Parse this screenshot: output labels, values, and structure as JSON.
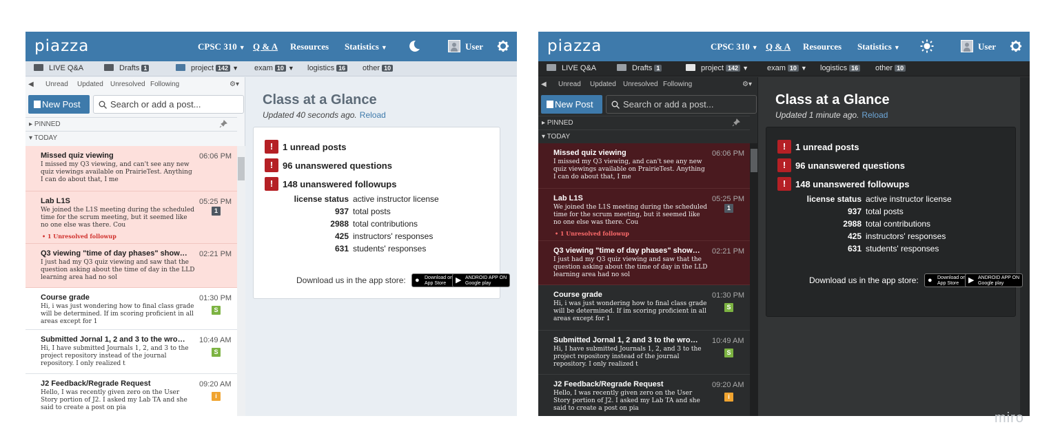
{
  "common": {
    "logo": "piazza",
    "nav": {
      "course": "CPSC 310",
      "qa": "Q & A",
      "resources": "Resources",
      "statistics": "Statistics",
      "user": "User"
    },
    "folders": {
      "live": "LIVE Q&A",
      "drafts": "Drafts",
      "drafts_count": "1",
      "project": "project",
      "project_count": "142",
      "exam": "exam",
      "exam_count": "10",
      "logistics": "logistics",
      "logistics_count": "16",
      "other": "other",
      "other_count": "10"
    },
    "filters": {
      "unread": "Unread",
      "updated": "Updated",
      "unresolved": "Unresolved",
      "following": "Following"
    },
    "new_post": "New Post",
    "search_placeholder": "Search or add a post...",
    "pinned": "PINNED",
    "today": "TODAY",
    "posts": [
      {
        "title": "Missed quiz viewing",
        "time": "06:06 PM",
        "snippet": "I missed my Q3 viewing, and can't see any new quiz viewings available on PrairieTest. Anything I can do about that, I me"
      },
      {
        "title": "Lab L1S",
        "time": "05:25 PM",
        "snippet": "We joined the L1S meeting during the scheduled time for the scrum meeting, but it seemed like no one else was there. Cou",
        "flag": "1",
        "followup": "•  1 Unresolved followup"
      },
      {
        "title": "Q3 viewing \"time of day phases\" show…",
        "time": "02:21 PM",
        "snippet": "I just had my Q3 quiz viewing and saw that the question asking about the time of day in the LLD learning area had no sol"
      },
      {
        "title": "Course grade",
        "time": "01:30 PM",
        "snippet": "Hi, i was just wondering how to final class grade will be determined. If im scoring proficient in all areas except for 1",
        "flag": "S"
      },
      {
        "title": "Submitted Jornal 1, 2 and 3 to the wro…",
        "time": "10:49 AM",
        "snippet": "Hi, I have submitted Journals 1, 2, and 3 to the project repository instead of the journal repository. I only realized t",
        "flag": "S"
      },
      {
        "title": "J2 Feedback/Regrade Request",
        "time": "09:20 AM",
        "snippet": "Hello, I was recently given zero on the User Story portion of J2. I asked my Lab TA and she said to create a post on pia",
        "flag": "i"
      }
    ],
    "glance": {
      "title": "Class at a Glance",
      "reload": "Reload",
      "alerts": [
        "1 unread posts",
        "96 unanswered questions",
        "148 unanswered followups"
      ],
      "alert_icon": "!",
      "stats": [
        {
          "value": "license status",
          "label": "active instructor license"
        },
        {
          "value": "937",
          "label": "total posts"
        },
        {
          "value": "2988",
          "label": "total contributions"
        },
        {
          "value": "425",
          "label": "instructors' responses"
        },
        {
          "value": "631",
          "label": "students' responses"
        }
      ],
      "download": "Download us in the app store:",
      "appstore_small": "Download on the",
      "appstore": "App Store",
      "googleplay_small": "ANDROID APP ON",
      "googleplay": "Google play"
    }
  },
  "light": {
    "updated": "Updated 40 seconds ago.",
    "theme_icon": "moon-icon"
  },
  "dark": {
    "updated": "Updated 1 minute ago.",
    "theme_icon": "sun-icon"
  },
  "watermark": "miro",
  "colors": {
    "nav_blue": "#3e7aab",
    "unread_light": "#fde0dc",
    "unread_dark": "#4a1a1f",
    "alert_red": "#b52025",
    "dark_bg": "#333536"
  }
}
